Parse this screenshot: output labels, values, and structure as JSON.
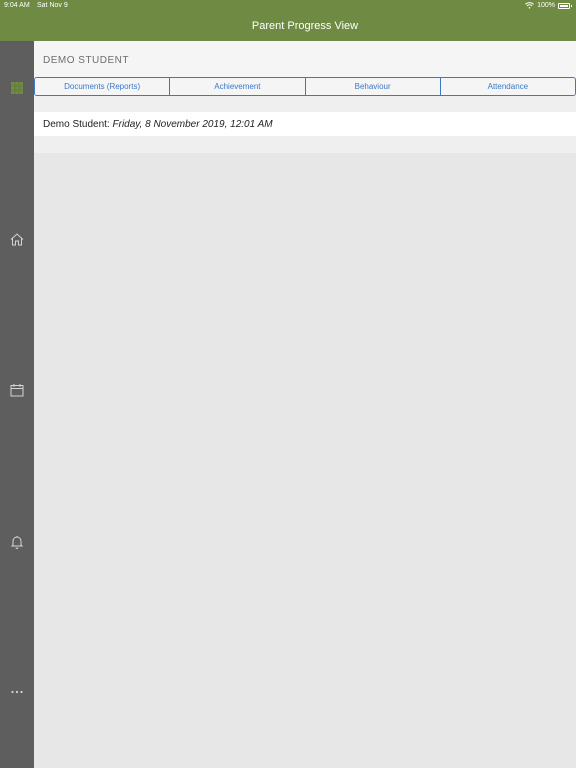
{
  "status_bar": {
    "time": "9:04 AM",
    "date": "Sat Nov 9",
    "battery": "100%"
  },
  "nav": {
    "title": "Parent Progress View"
  },
  "sidebar": {
    "items": [
      {
        "icon": "grid-icon",
        "active": true
      },
      {
        "icon": "home-icon"
      },
      {
        "icon": "calendar-icon"
      },
      {
        "icon": "bell-icon"
      },
      {
        "icon": "more-icon"
      }
    ]
  },
  "student": {
    "name": "DEMO STUDENT"
  },
  "tabs": [
    {
      "label": "Documents (Reports)"
    },
    {
      "label": "Achievement"
    },
    {
      "label": "Behaviour"
    },
    {
      "label": "Attendance"
    }
  ],
  "document_row": {
    "owner": "Demo Student:",
    "timestamp": "Friday, 8 November 2019, 12:01 AM"
  },
  "colors": {
    "brand": "#6f8b43",
    "sidebar": "#5e5e5e",
    "accent": "#3c78c7",
    "grid_icon": "#6f8b43"
  }
}
